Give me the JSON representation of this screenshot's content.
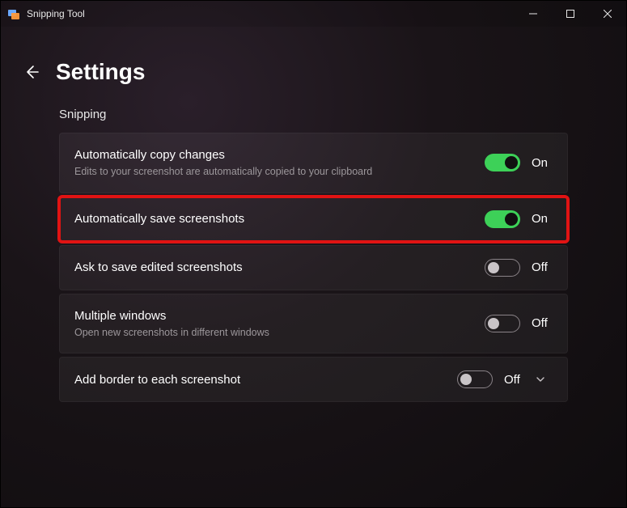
{
  "window": {
    "title": "Snipping Tool"
  },
  "header": {
    "title": "Settings"
  },
  "section": {
    "title": "Snipping"
  },
  "settings": [
    {
      "title": "Automatically copy changes",
      "desc": "Edits to your screenshot are automatically copied to your clipboard",
      "state": "On",
      "on": true,
      "highlighted": false,
      "expandable": false
    },
    {
      "title": "Automatically save screenshots",
      "desc": "",
      "state": "On",
      "on": true,
      "highlighted": true,
      "expandable": false
    },
    {
      "title": "Ask to save edited screenshots",
      "desc": "",
      "state": "Off",
      "on": false,
      "highlighted": false,
      "expandable": false
    },
    {
      "title": "Multiple windows",
      "desc": "Open new screenshots in different windows",
      "state": "Off",
      "on": false,
      "highlighted": false,
      "expandable": false
    },
    {
      "title": "Add border to each screenshot",
      "desc": "",
      "state": "Off",
      "on": false,
      "highlighted": false,
      "expandable": true
    }
  ]
}
